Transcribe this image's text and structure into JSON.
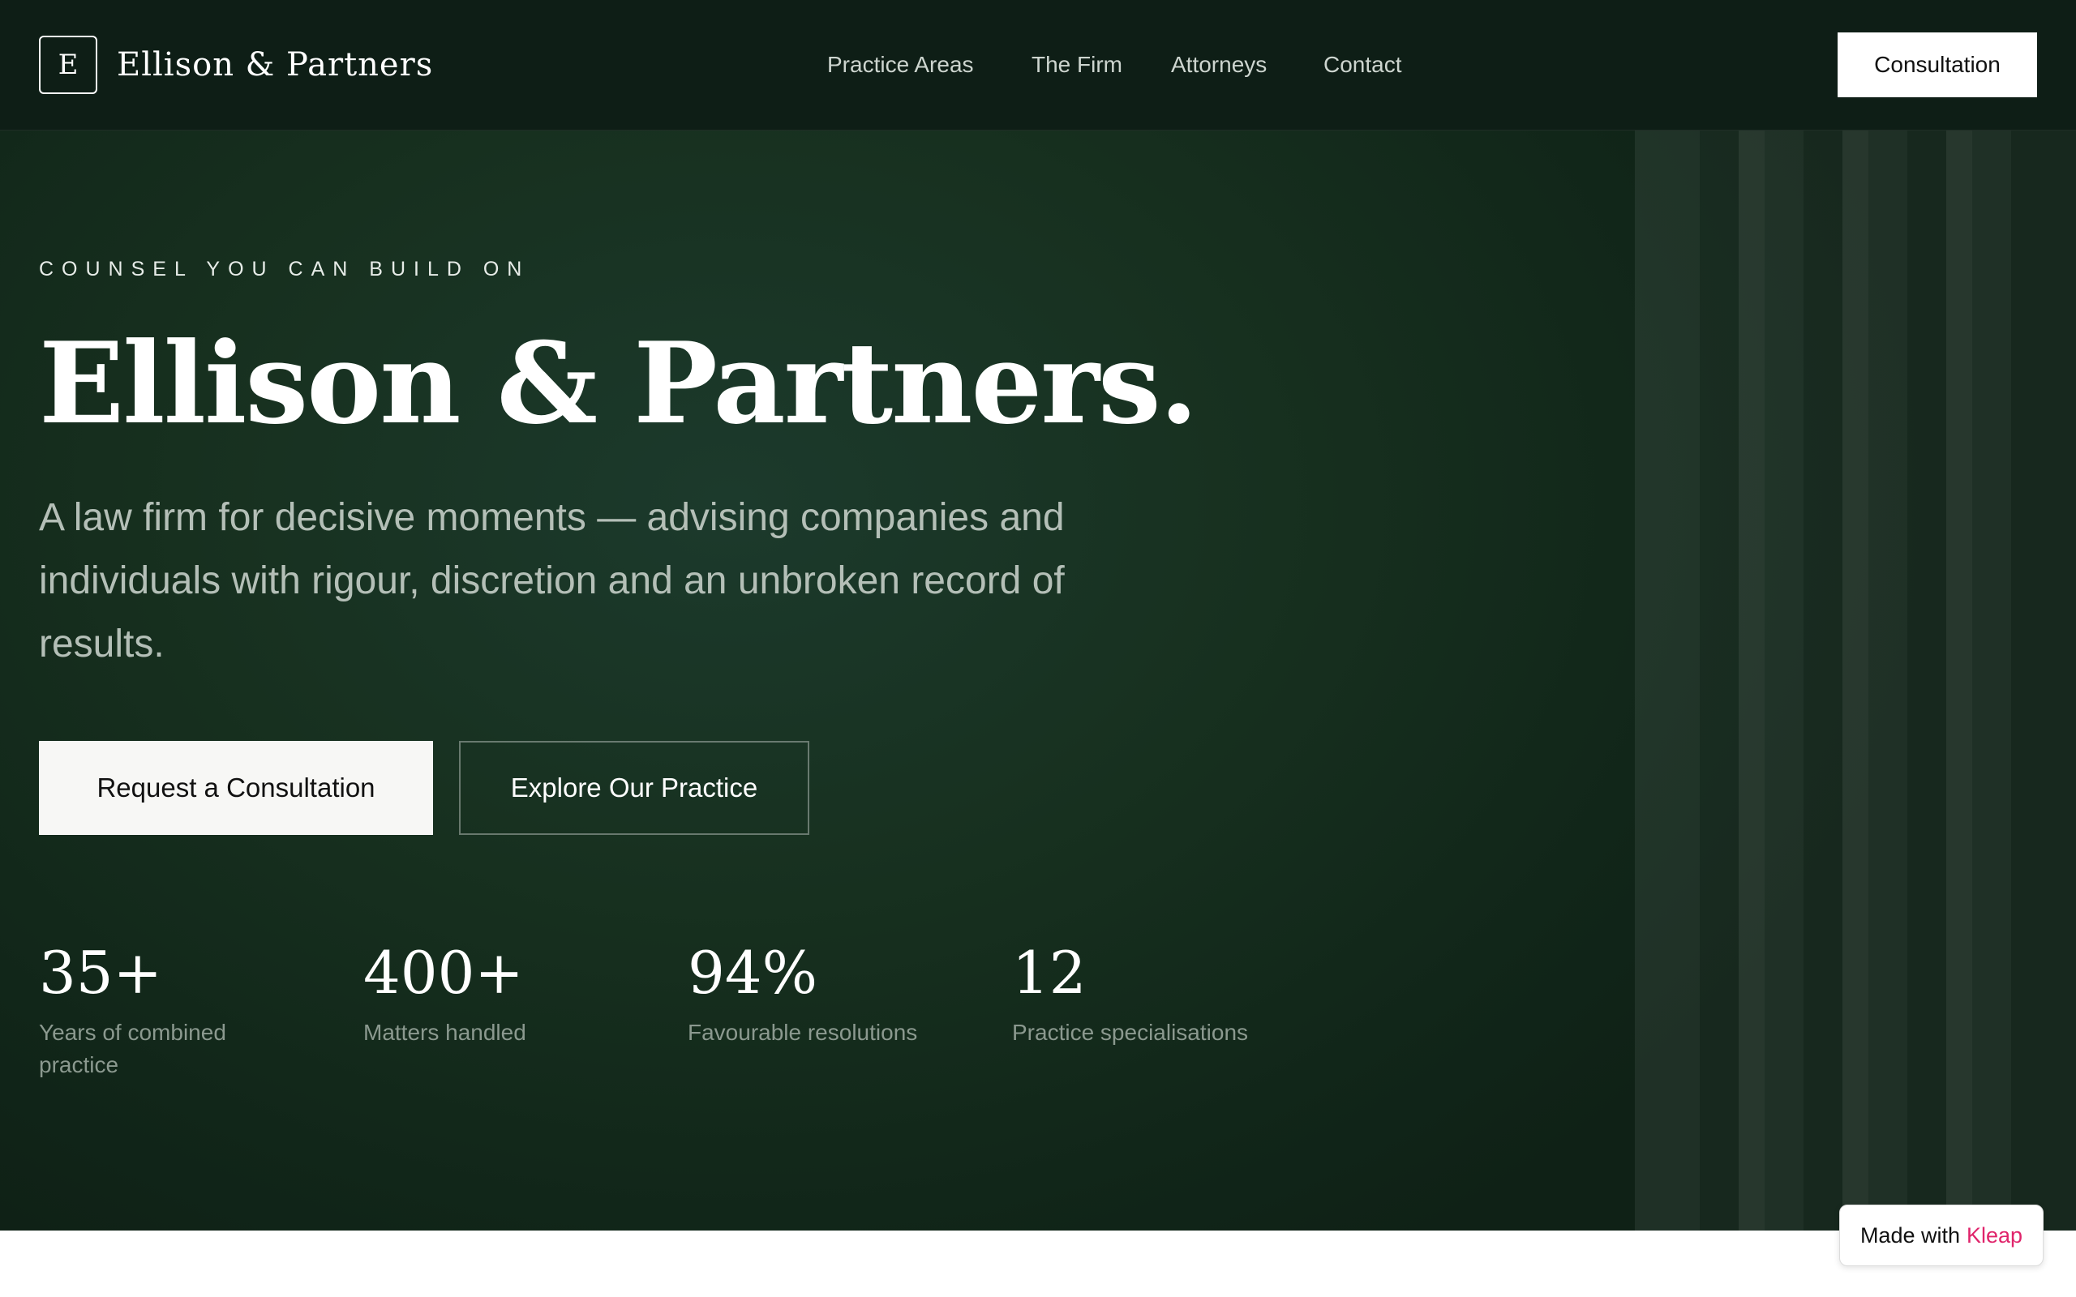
{
  "header": {
    "logo_letter": "E",
    "brand_name": "Ellison & Partners",
    "nav": [
      {
        "label": "Practice Areas"
      },
      {
        "label": "The Firm"
      },
      {
        "label": "Attorneys"
      },
      {
        "label": "Contact"
      }
    ],
    "cta_label": "Consultation"
  },
  "hero": {
    "eyebrow": "COUNSEL YOU CAN BUILD ON",
    "headline": "Ellison & Partners.",
    "lede": "A law firm for decisive moments — advising companies and individuals with rigour, discretion and an unbroken record of results.",
    "primary_cta": "Request a Consultation",
    "secondary_cta": "Explore Our Practice"
  },
  "stats": [
    {
      "value": "35+",
      "label": "Years of combined practice"
    },
    {
      "value": "400+",
      "label": "Matters handled"
    },
    {
      "value": "94%",
      "label": "Favourable resolutions"
    },
    {
      "value": "12",
      "label": "Practice specialisations"
    }
  ],
  "badge": {
    "prefix": "Made with",
    "brand": "Kleap"
  },
  "colors": {
    "hero_background": "#17301f",
    "nav_background": "#0e1e16",
    "badge_brand": "#e0246b"
  }
}
